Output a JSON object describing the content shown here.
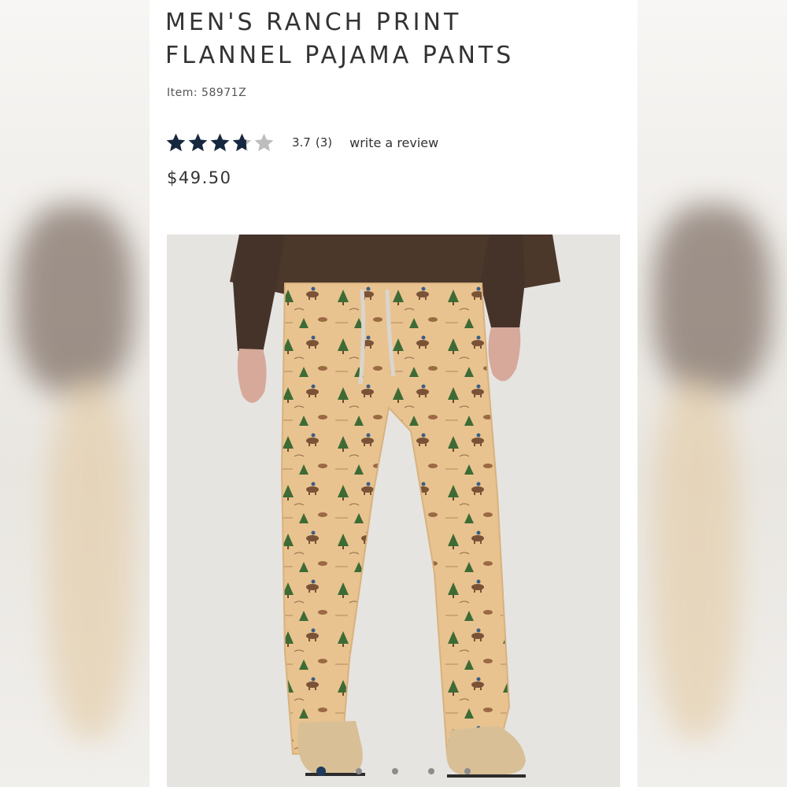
{
  "product": {
    "title_line1": "MEN'S RANCH PRINT",
    "title_line2": "FLANNEL PAJAMA PANTS",
    "item_label": "Item: 58971Z",
    "price": "$49.50"
  },
  "rating": {
    "value": 3.7,
    "value_text": "3.7",
    "count_text": "(3)",
    "max": 5,
    "star_color": "#16283f",
    "empty_star_color": "#bdbdbd",
    "review_link": "write a review"
  },
  "gallery": {
    "image_count": 5,
    "active_index": 0,
    "active_dot_color": "#1f3a5c"
  },
  "colors": {
    "pants": "#e8c38f",
    "sweater": "#4b382b",
    "background": "#e6e4e1"
  }
}
